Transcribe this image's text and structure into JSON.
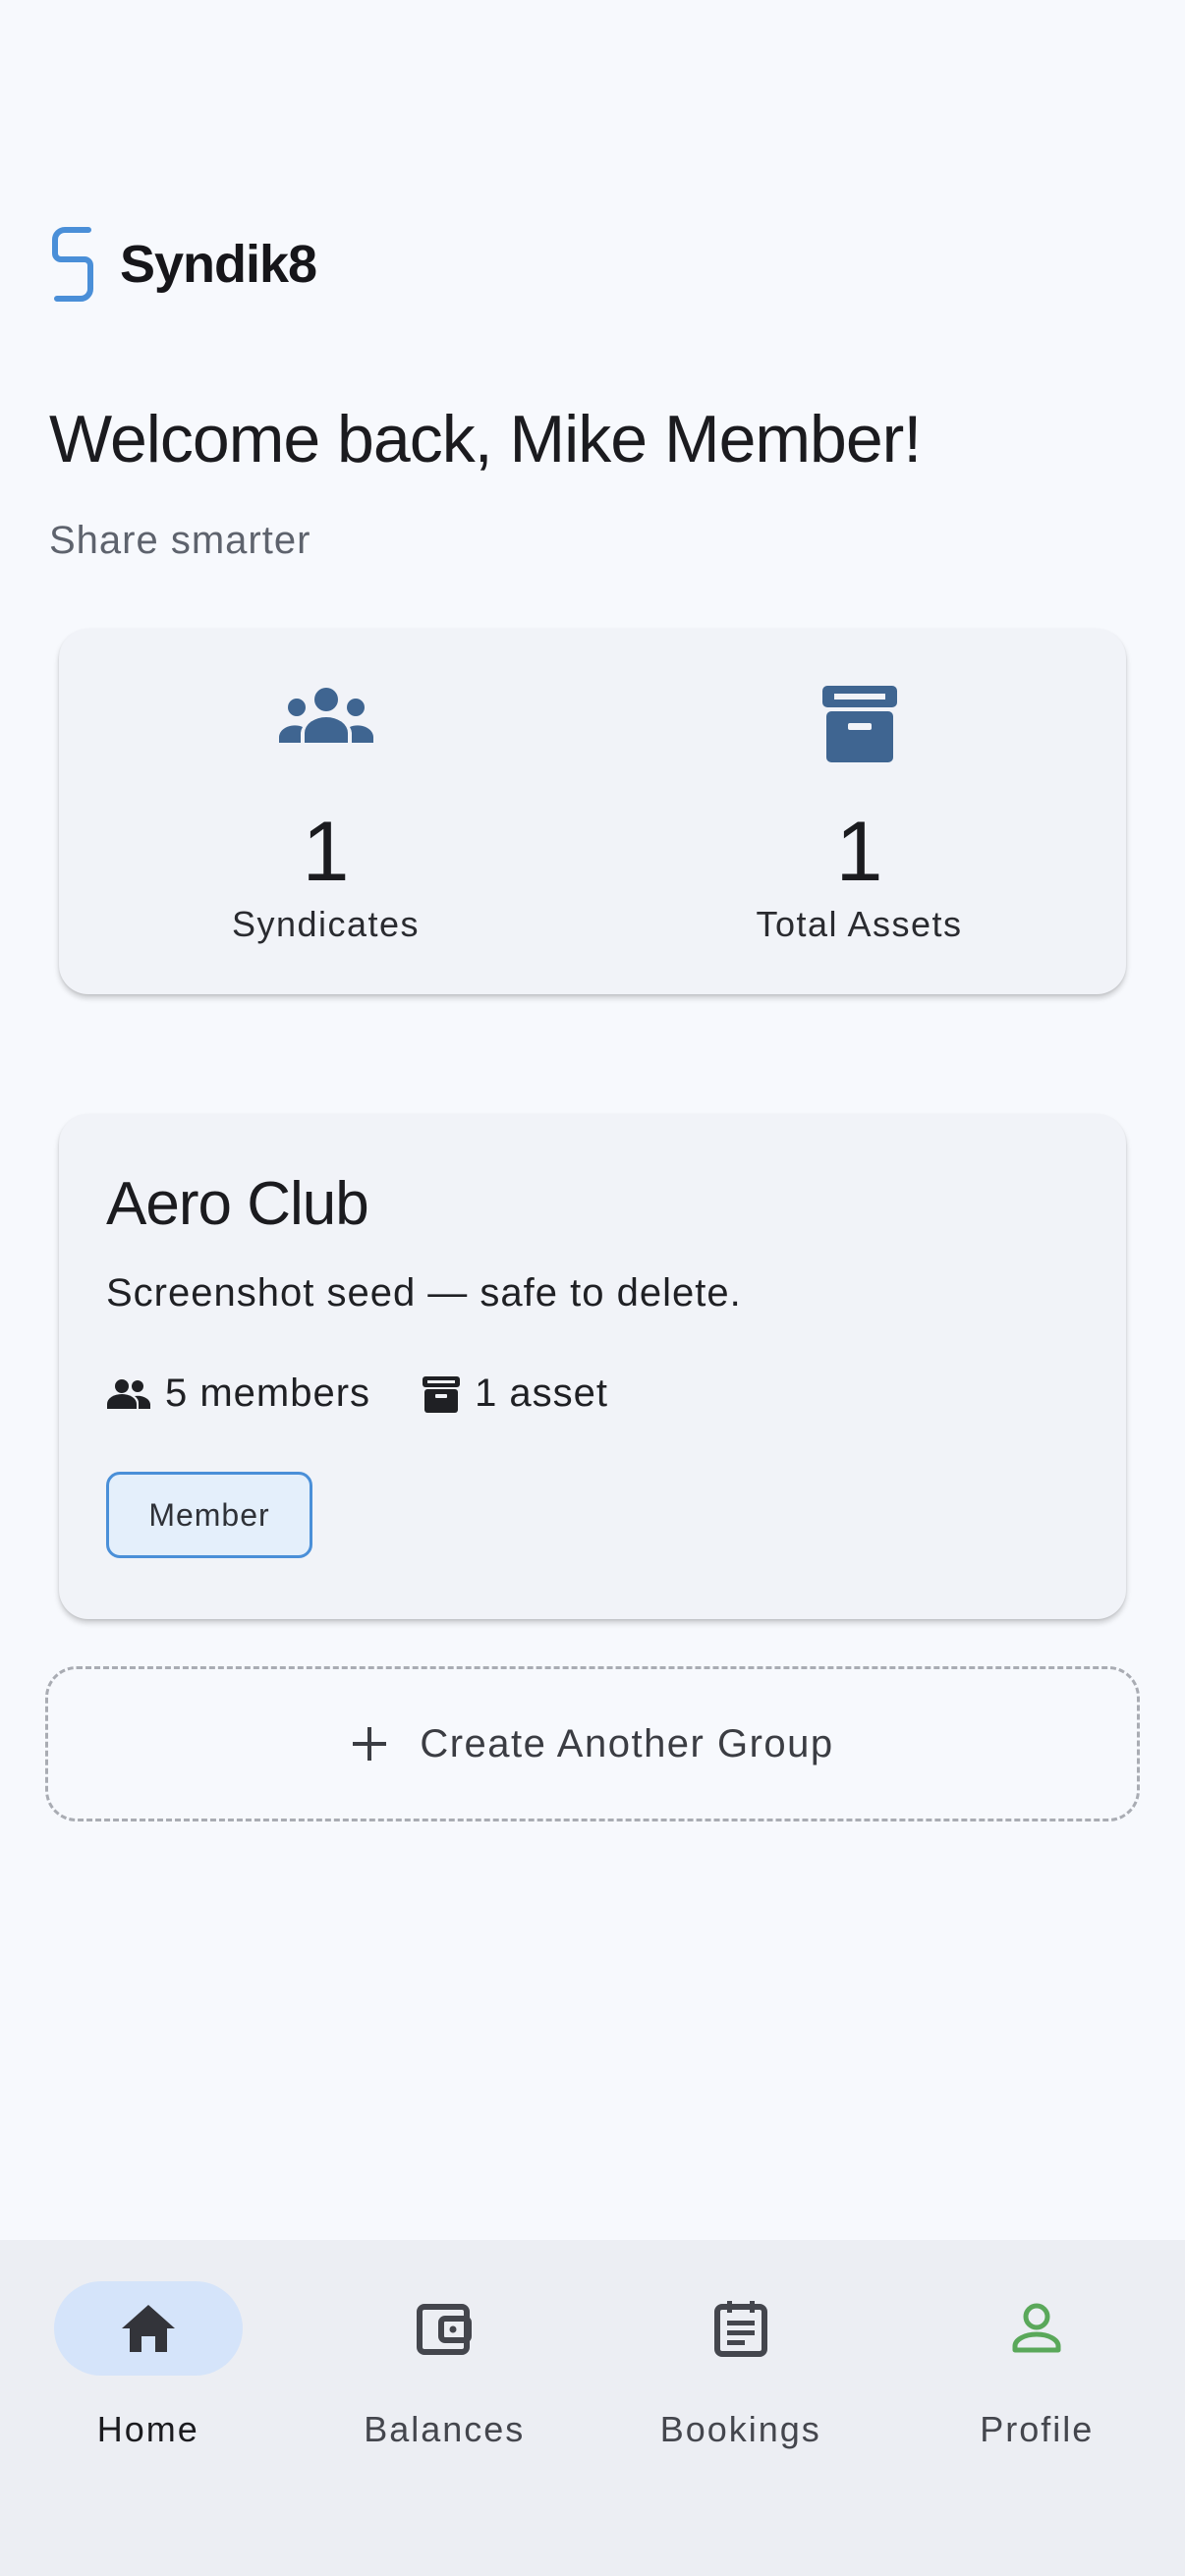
{
  "app": {
    "name": "Syndik8"
  },
  "header": {
    "welcome": "Welcome back, Mike Member!",
    "tagline": "Share smarter"
  },
  "stats": {
    "syndicates": {
      "value": "1",
      "label": "Syndicates",
      "icon": "group-icon"
    },
    "assets": {
      "value": "1",
      "label": "Total Assets",
      "icon": "archive-box-icon"
    }
  },
  "group": {
    "title": "Aero Club",
    "description": "Screenshot seed — safe to delete.",
    "members": "5 members",
    "assets": "1 asset",
    "role": "Member"
  },
  "create_group": {
    "label": "Create Another Group",
    "icon": "plus-icon"
  },
  "nav": {
    "items": [
      {
        "label": "Home",
        "icon": "home-icon",
        "active": true
      },
      {
        "label": "Balances",
        "icon": "wallet-icon",
        "active": false
      },
      {
        "label": "Bookings",
        "icon": "clipboard-icon",
        "active": false
      },
      {
        "label": "Profile",
        "icon": "person-icon",
        "active": false
      }
    ]
  },
  "colors": {
    "accent": "#3f6591",
    "logo": "#4a8fd8",
    "nav_active_pill": "#d5e4fa",
    "profile_icon": "#5aa85a",
    "badge_border": "#4a8fd8"
  }
}
